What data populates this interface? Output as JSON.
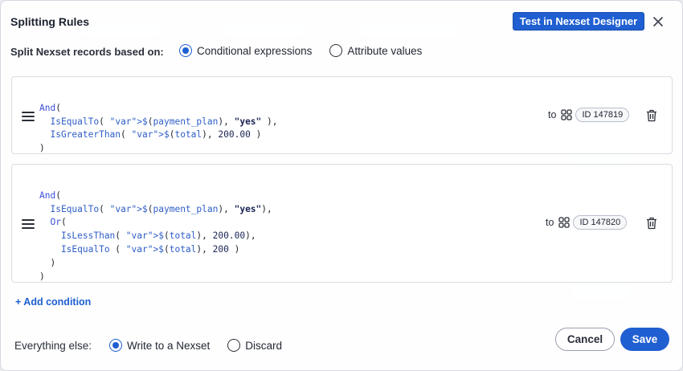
{
  "dialog": {
    "title": "Splitting Rules",
    "test_button": "Test in Nexset Designer",
    "close_icon": "close-icon"
  },
  "split_mode": {
    "label": "Split Nexset records based on:",
    "options": [
      {
        "label": "Conditional expressions",
        "selected": true
      },
      {
        "label": "Attribute values",
        "selected": false
      }
    ]
  },
  "conditions": [
    {
      "lines": [
        "And(",
        "  IsEqualTo( $(payment_plan), \"yes\" ),",
        "  IsGreaterThan( $(total), 200.00 )",
        ")"
      ],
      "to_label": "to",
      "target_id": "ID 147819"
    },
    {
      "lines": [
        "And(",
        "  IsEqualTo( $(payment_plan), \"yes\"),",
        "  Or(",
        "    IsLessThan( $(total), 200.00),",
        "    IsEqualTo ( $(total), 200 )",
        "  )",
        ")"
      ],
      "to_label": "to",
      "target_id": "ID 147820"
    }
  ],
  "add_condition": "+ Add condition",
  "everything_else": {
    "label": "Everything else:",
    "options": [
      {
        "label": "Write to a Nexset",
        "selected": true
      },
      {
        "label": "Discard",
        "selected": false
      }
    ]
  },
  "footer": {
    "cancel": "Cancel",
    "save": "Save"
  },
  "colors": {
    "accent": "#1f5fd1",
    "string": "#1b2455",
    "variable": "#7a4a00",
    "function": "#2e5ec7"
  }
}
